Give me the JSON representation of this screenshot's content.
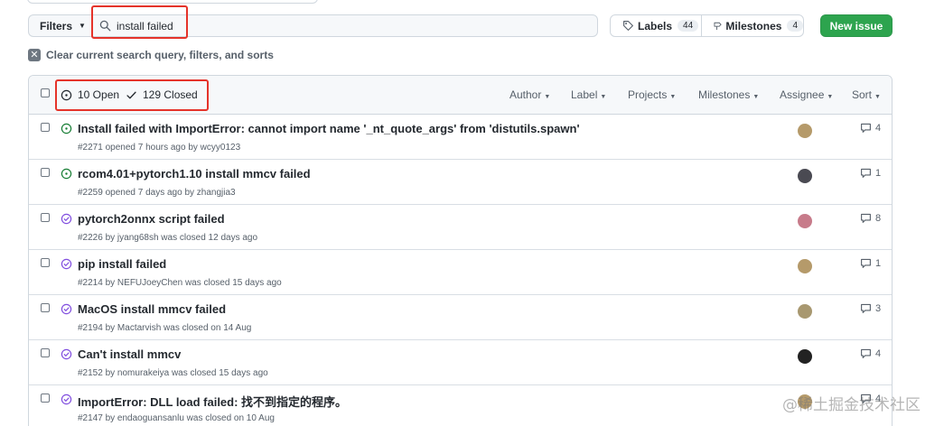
{
  "toolbar": {
    "filters_label": "Filters",
    "search_value": "install failed",
    "labels_label": "Labels",
    "labels_count": "44",
    "milestones_label": "Milestones",
    "milestones_count": "4",
    "new_issue_label": "New issue"
  },
  "clear_query_label": "Clear current search query, filters, and sorts",
  "header": {
    "open_label": "10 Open",
    "closed_label": "129 Closed",
    "filters": [
      "Author",
      "Label",
      "Projects",
      "Milestones",
      "Assignee",
      "Sort"
    ]
  },
  "issues": [
    {
      "title": "Install failed with ImportError: cannot import name '_nt_quote_args' from 'distutils.spawn'",
      "meta": "#2271 opened 7 hours ago by wcyy0123",
      "state": "open",
      "comments": "4",
      "avatar_color": "#b59a6a"
    },
    {
      "title": "rcom4.01+pytorch1.10 install mmcv failed",
      "meta": "#2259 opened 7 days ago by zhangjia3",
      "state": "open",
      "comments": "1",
      "avatar_color": "#4a4a52"
    },
    {
      "title": "pytorch2onnx script failed",
      "meta": "#2226 by jyang68sh was closed 12 days ago",
      "state": "closed",
      "comments": "8",
      "avatar_color": "#c77b8a"
    },
    {
      "title": "pip install failed",
      "meta": "#2214 by NEFUJoeyChen was closed 15 days ago",
      "state": "closed",
      "comments": "1",
      "avatar_color": "#b59a6a"
    },
    {
      "title": "MacOS install mmcv failed",
      "meta": "#2194 by Mactarvish was closed on 14 Aug",
      "state": "closed",
      "comments": "3",
      "avatar_color": "#a89870"
    },
    {
      "title": "Can't install mmcv",
      "meta": "#2152 by nomurakeiya was closed 15 days ago",
      "state": "closed",
      "comments": "4",
      "avatar_color": "#222222"
    },
    {
      "title": "ImportError: DLL load failed: 找不到指定的程序。",
      "meta": "#2147 by endaoguansanlu was closed on 10 Aug",
      "state": "closed",
      "comments": "4",
      "avatar_color": "#b59a6a"
    }
  ],
  "colors": {
    "open": "#1a7f37",
    "closed": "#8250df",
    "primary_button": "#2da44e",
    "highlight": "#e5332a"
  },
  "watermark": "@稀土掘金技术社区"
}
